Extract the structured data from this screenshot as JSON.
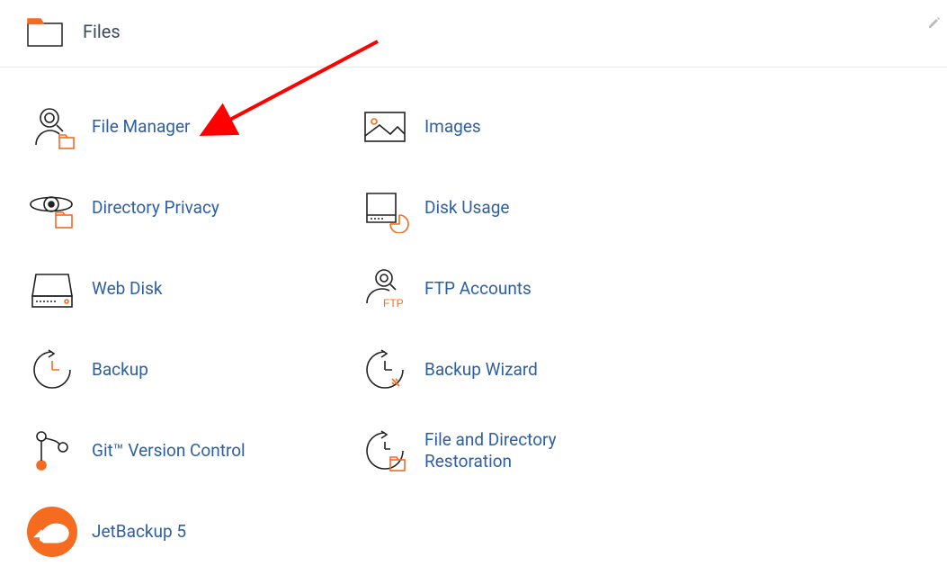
{
  "header": {
    "title": "Files"
  },
  "annotation": {
    "type": "arrow",
    "color": "#ff0000"
  },
  "tools": {
    "file_manager": {
      "label": "File Manager"
    },
    "images": {
      "label": "Images"
    },
    "directory_privacy": {
      "label": "Directory Privacy"
    },
    "disk_usage": {
      "label": "Disk Usage"
    },
    "web_disk": {
      "label": "Web Disk"
    },
    "ftp_accounts": {
      "label": "FTP Accounts"
    },
    "backup": {
      "label": "Backup"
    },
    "backup_wizard": {
      "label": "Backup Wizard"
    },
    "git_version_control": {
      "label": "Git™ Version Control"
    },
    "file_restoration": {
      "label": "File and Directory Restoration"
    },
    "jetbackup": {
      "label": "JetBackup 5"
    }
  },
  "colors": {
    "accent": "#f56b1f",
    "link": "#2d5fa4",
    "outline": "#222222"
  }
}
